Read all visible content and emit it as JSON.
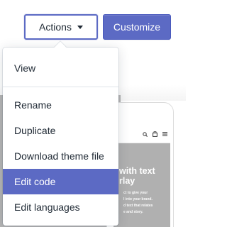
{
  "toolbar": {
    "actions_label": "Actions",
    "customize_label": "Customize"
  },
  "dropdown": {
    "items": [
      {
        "label": "View"
      },
      {
        "label": "Rename"
      },
      {
        "label": "Duplicate"
      },
      {
        "label": "Download theme file"
      },
      {
        "label": "Edit code",
        "active": true
      },
      {
        "label": "Edit languages"
      }
    ]
  },
  "preview": {
    "hero_title": "with text\nrlay",
    "hero_body": "ct to give your\nl into your brand.\nd text that relates\ne and story."
  },
  "colors": {
    "accent": "#5c6ac4",
    "text": "#212b36",
    "divider": "#dfe3e8",
    "preview_gray": "#b5b5b5"
  },
  "icons": [
    "chevron-down-icon",
    "search-icon",
    "bag-icon",
    "menu-icon"
  ]
}
